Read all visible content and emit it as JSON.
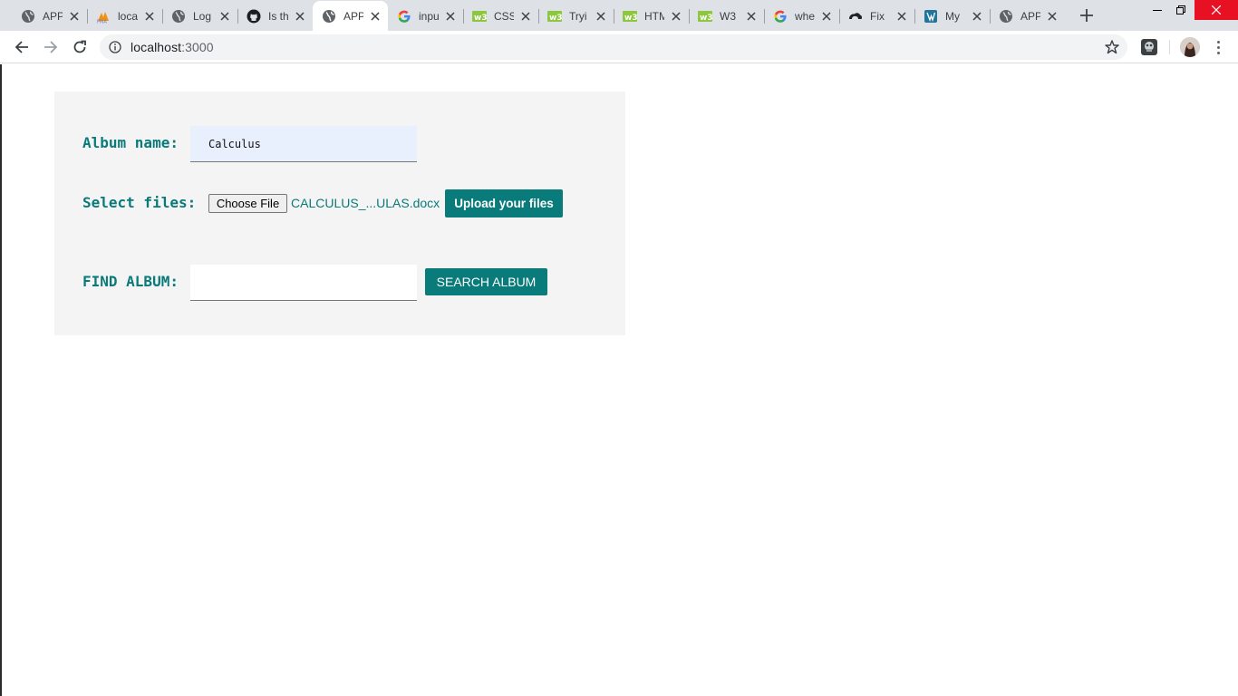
{
  "browser": {
    "tabs": [
      {
        "title": "APP",
        "icon": "globe-icon"
      },
      {
        "title": "localhost",
        "icon": "phpmyadmin-icon"
      },
      {
        "title": "Log",
        "icon": "globe-icon"
      },
      {
        "title": "Is th",
        "icon": "github-icon"
      },
      {
        "title": "APP",
        "icon": "globe-icon",
        "active": true
      },
      {
        "title": "inpu",
        "icon": "google-icon"
      },
      {
        "title": "CSS",
        "icon": "w3schools-icon"
      },
      {
        "title": "Tryi",
        "icon": "w3schools-icon"
      },
      {
        "title": "HTM",
        "icon": "w3schools-icon"
      },
      {
        "title": "W3",
        "icon": "w3schools-icon"
      },
      {
        "title": "whe",
        "icon": "google-icon"
      },
      {
        "title": "Fix",
        "icon": "cloud-icon"
      },
      {
        "title": "My",
        "icon": "docs-icon"
      },
      {
        "title": "APP",
        "icon": "globe-icon"
      }
    ],
    "url_host": "localhost",
    "url_port": ":3000"
  },
  "form": {
    "album_label": "Album name:",
    "album_value": "Calculus",
    "files_label": "Select files:",
    "choose_file_label": "Choose File",
    "file_name": "CALCULUS_...ULAS.docx",
    "upload_label": "Upload your files",
    "find_label": "FIND ALBUM:",
    "find_value": "",
    "search_label": "SEARCH ALBUM"
  },
  "colors": {
    "accent": "#087b7a",
    "label": "#0a7a79",
    "card_bg": "#f4f4f4",
    "autofill_bg": "#e8f0fe",
    "tabstrip_bg": "#dee1e6",
    "close_red": "#e81123"
  }
}
